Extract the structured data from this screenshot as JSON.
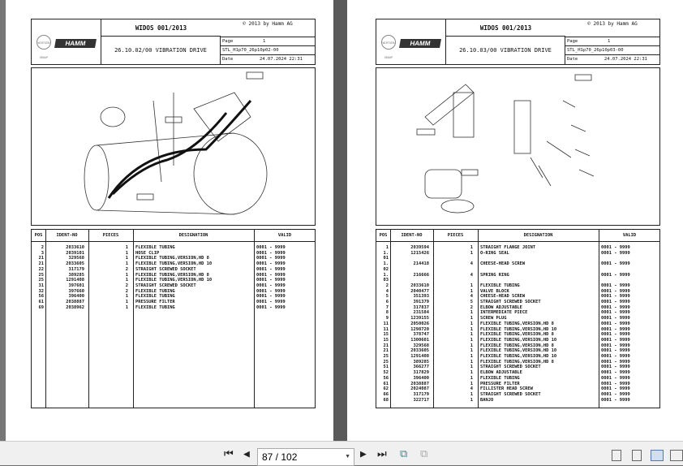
{
  "pages": [
    {
      "title": "WIDOS 001/2013",
      "copyright": "© 2013 by Hamm AG",
      "brand": "HAMM",
      "group": "WIRTGEN GROUP",
      "subtitle": "26.10.02/00 VIBRATION DRIVE",
      "page_label": "Page",
      "page_no": "1",
      "stl": "STL_H1p70_26p10p02-00",
      "date_label": "Date",
      "date": "24.07.2024  22:31",
      "headers": [
        "POS",
        "IDENT-NO",
        "PIECES",
        "DESIGNATION",
        "VALID"
      ],
      "rows": [
        [
          "2",
          "2033610",
          "1",
          "FLEXIBLE TUBING",
          "0001 - 9999"
        ],
        [
          "3",
          "2039101",
          "1",
          "HOSE CLIP",
          "0001 - 9999"
        ],
        [
          "21",
          "329568",
          "1",
          "FLEXIBLE TUBING,VERSION,HD 8",
          "0001 - 9999"
        ],
        [
          "21",
          "2033605",
          "1",
          "FLEXIBLE TUBING,VERSION,HD 10",
          "0001 - 9999"
        ],
        [
          "22",
          "317179",
          "2",
          "STRAIGHT SCREWED SOCKET",
          "0001 - 9999"
        ],
        [
          "25",
          "389285",
          "1",
          "FLEXIBLE TUBING,VERSION,HD 8",
          "0001 - 9999"
        ],
        [
          "25",
          "1291408",
          "1",
          "FLEXIBLE TUBING,VERSION,HD 10",
          "0001 - 9999"
        ],
        [
          "31",
          "397601",
          "2",
          "STRAIGHT SCREWED SOCKET",
          "0001 - 9999"
        ],
        [
          "32",
          "397660",
          "2",
          "FLEXIBLE TUBING",
          "0001 - 9999"
        ],
        [
          "56",
          "396400",
          "1",
          "FLEXIBLE TUBING",
          "0001 - 9999"
        ],
        [
          "61",
          "2038887",
          "1",
          "PRESSURE FILTER",
          "0001 - 9999"
        ],
        [
          "69",
          "2038962",
          "1",
          "FLEXIBLE TUBING",
          "0001 - 9999"
        ]
      ]
    },
    {
      "title": "WIDOS 001/2013",
      "copyright": "© 2013 by Hamm AG",
      "brand": "HAMM",
      "group": "WIRTGEN GROUP",
      "subtitle": "26.10.03/00 VIBRATION DRIVE",
      "page_label": "Page",
      "page_no": "1",
      "stl": "STL_H1p70_26p10p03-00",
      "date_label": "Date",
      "date": "24.07.2024  22:31",
      "headers": [
        "POS",
        "IDENT-NO",
        "PIECES",
        "DESIGNATION",
        "VALID"
      ],
      "rows": [
        [
          "1",
          "2039594",
          "1",
          "STRAIGHT FLANGE JOINT",
          "0001 - 9999"
        ],
        [
          "1.\n01",
          "1215426",
          "1",
          "O-RING SEAL",
          "0001 - 9999"
        ],
        [
          "1.\n02",
          "214418",
          "4",
          "CHEESE-HEAD SCREW",
          "0001 - 9999"
        ],
        [
          "1.\n03",
          "216666",
          "4",
          "SPRING RING",
          "0001 - 9999"
        ],
        [
          "2",
          "2033610",
          "1",
          "FLEXIBLE TUBING",
          "0001 - 9999"
        ],
        [
          "4",
          "2040477",
          "1",
          "VALVE BLOCK",
          "0001 - 9999"
        ],
        [
          "5",
          "351393",
          "4",
          "CHEESE-HEAD SCREW",
          "0001 - 9999"
        ],
        [
          "6",
          "391379",
          "5",
          "STRAIGHT SCREWED SOCKET",
          "0001 - 9999"
        ],
        [
          "7",
          "317837",
          "2",
          "ELBOW ADJUSTABLE",
          "0001 - 9999"
        ],
        [
          "8",
          "231584",
          "1",
          "INTERMEDIATE PIECE",
          "0001 - 9999"
        ],
        [
          "9",
          "1239155",
          "1",
          "SCREW PLUG",
          "0001 - 9999"
        ],
        [
          "11",
          "2050026",
          "1",
          "FLEXIBLE TUBING,VERSION,HD 8",
          "0001 - 9999"
        ],
        [
          "11",
          "1298720",
          "1",
          "FLEXIBLE TUBING,VERSION,HD 10",
          "0001 - 9999"
        ],
        [
          "15",
          "378747",
          "1",
          "FLEXIBLE TUBING,VERSION,HD 8",
          "0001 - 9999"
        ],
        [
          "15",
          "1300601",
          "1",
          "FLEXIBLE TUBING,VERSION,HD 10",
          "0001 - 9999"
        ],
        [
          "21",
          "329568",
          "1",
          "FLEXIBLE TUBING,VERSION,HD 8",
          "0001 - 9999"
        ],
        [
          "21",
          "2033605",
          "1",
          "FLEXIBLE TUBING,VERSION,HD 10",
          "0001 - 9999"
        ],
        [
          "25",
          "1291408",
          "1",
          "FLEXIBLE TUBING,VERSION,HD 10",
          "0001 - 9999"
        ],
        [
          "25",
          "389285",
          "1",
          "FLEXIBLE TUBING,VERSION,HD 8",
          "0001 - 9999"
        ],
        [
          "51",
          "366277",
          "1",
          "STRAIGHT SCREWED SOCKET",
          "0001 - 9999"
        ],
        [
          "52",
          "317829",
          "1",
          "ELBOW ADJUSTABLE",
          "0001 - 9999"
        ],
        [
          "56",
          "396400",
          "1",
          "FLEXIBLE TUBING",
          "0001 - 9999"
        ],
        [
          "61",
          "2038887",
          "1",
          "PRESSURE FILTER",
          "0001 - 9999"
        ],
        [
          "62",
          "2024087",
          "4",
          "FILLISTER HEAD SCREW",
          "0001 - 9999"
        ],
        [
          "66",
          "317179",
          "1",
          "STRAIGHT SCREWED SOCKET",
          "0001 - 9999"
        ],
        [
          "68",
          "322717",
          "1",
          "BANJO",
          "0001 - 9999"
        ]
      ]
    }
  ],
  "toolbar": {
    "page_indicator": "87 / 102"
  }
}
